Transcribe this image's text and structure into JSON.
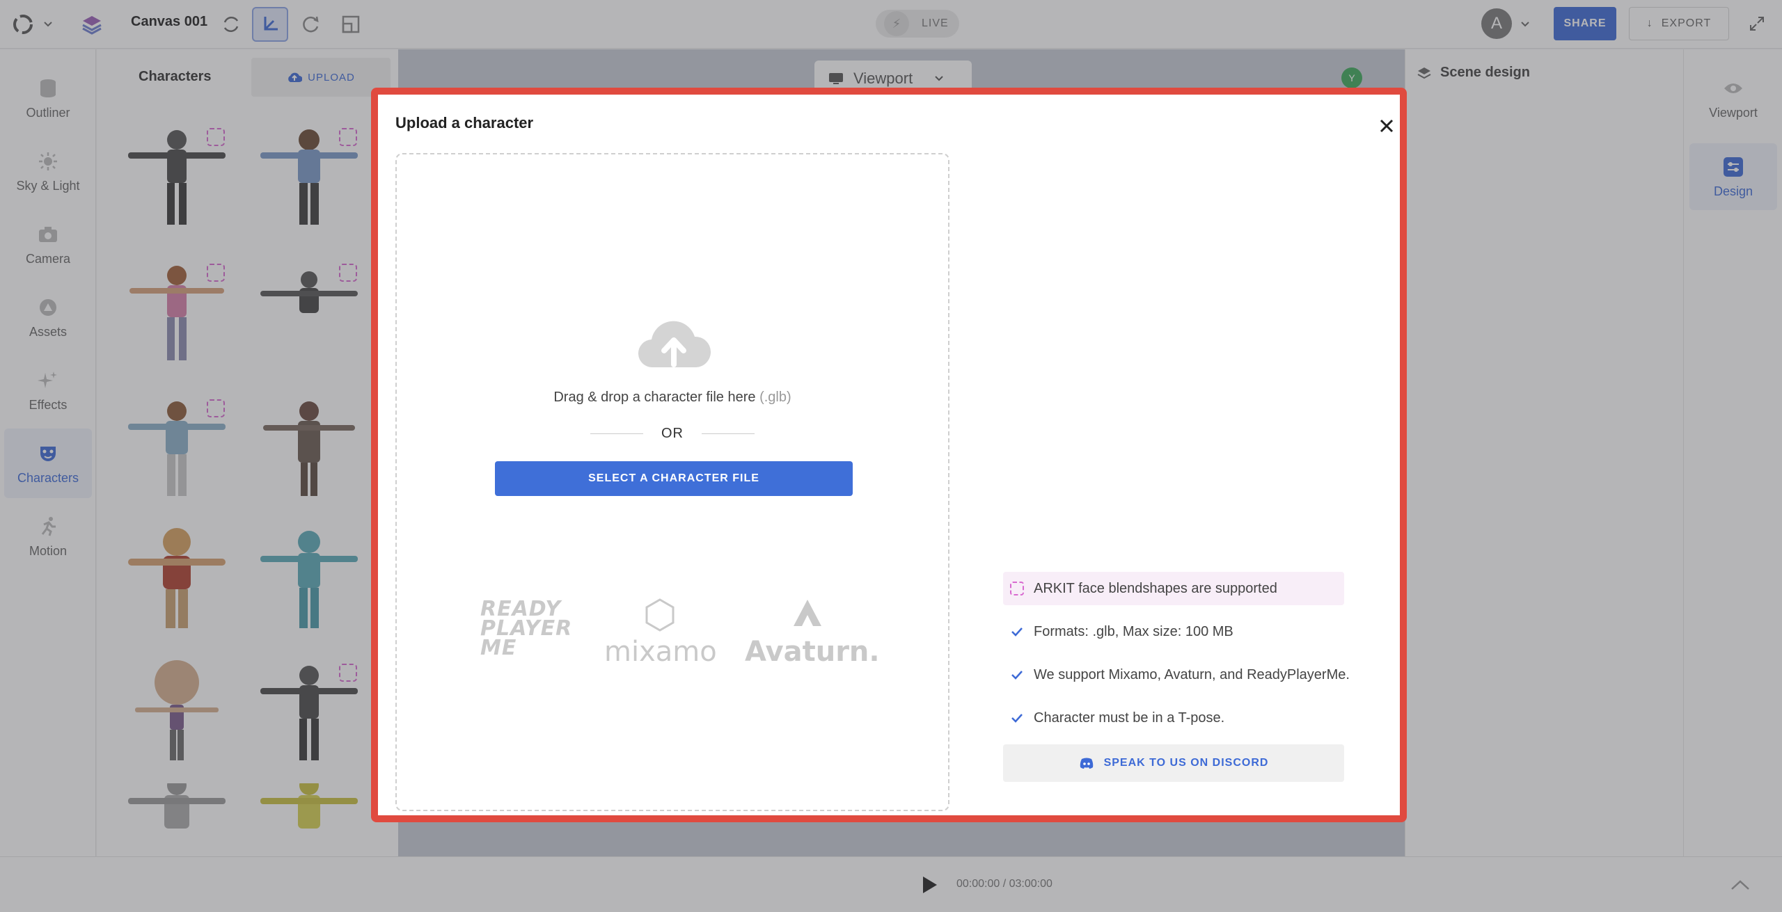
{
  "topbar": {
    "project_title": "Canvas 001",
    "live_label": "LIVE",
    "avatar_initial": "A",
    "share_label": "SHARE",
    "export_label": "EXPORT"
  },
  "left_rail": {
    "items": [
      {
        "label": "Outliner",
        "icon": "database-icon"
      },
      {
        "label": "Sky & Light",
        "icon": "sun-icon"
      },
      {
        "label": "Camera",
        "icon": "camera-icon"
      },
      {
        "label": "Assets",
        "icon": "assets-icon"
      },
      {
        "label": "Effects",
        "icon": "sparkle-icon"
      },
      {
        "label": "Characters",
        "icon": "mask-icon",
        "active": true
      },
      {
        "label": "Motion",
        "icon": "running-icon"
      }
    ]
  },
  "character_panel": {
    "title": "Characters",
    "upload_label": "UPLOAD"
  },
  "viewport": {
    "selector_label": "Viewport",
    "indicator": "Y"
  },
  "right_panel": {
    "title": "Scene design"
  },
  "right_rail": {
    "items": [
      {
        "label": "Viewport",
        "icon": "eye-icon"
      },
      {
        "label": "Design",
        "icon": "sliders-icon",
        "active": true
      }
    ]
  },
  "timeline": {
    "time": "00:00:00 / 03:00:00"
  },
  "modal": {
    "title": "Upload a character",
    "drop_text": "Drag & drop a character file here",
    "drop_ext": "(.glb)",
    "or_text": "OR",
    "select_button": "SELECT A CHARACTER FILE",
    "logos": {
      "rpm_line1": "READY",
      "rpm_line2": "PLAYER",
      "rpm_line3": "ME",
      "mixamo": "mixamo",
      "avaturn": "Avaturn."
    },
    "arkit_text": "ARKIT face blendshapes are supported",
    "checks": [
      "Formats: .glb, Max size: 100 MB",
      "We support Mixamo, Avaturn, and ReadyPlayerMe.",
      "Character must be in a T-pose."
    ],
    "discord_button": "SPEAK TO US ON DISCORD"
  },
  "colors": {
    "accent": "#3f6fd8",
    "modal_border": "#e04a3f",
    "arkit_badge": "#d86ad0"
  }
}
